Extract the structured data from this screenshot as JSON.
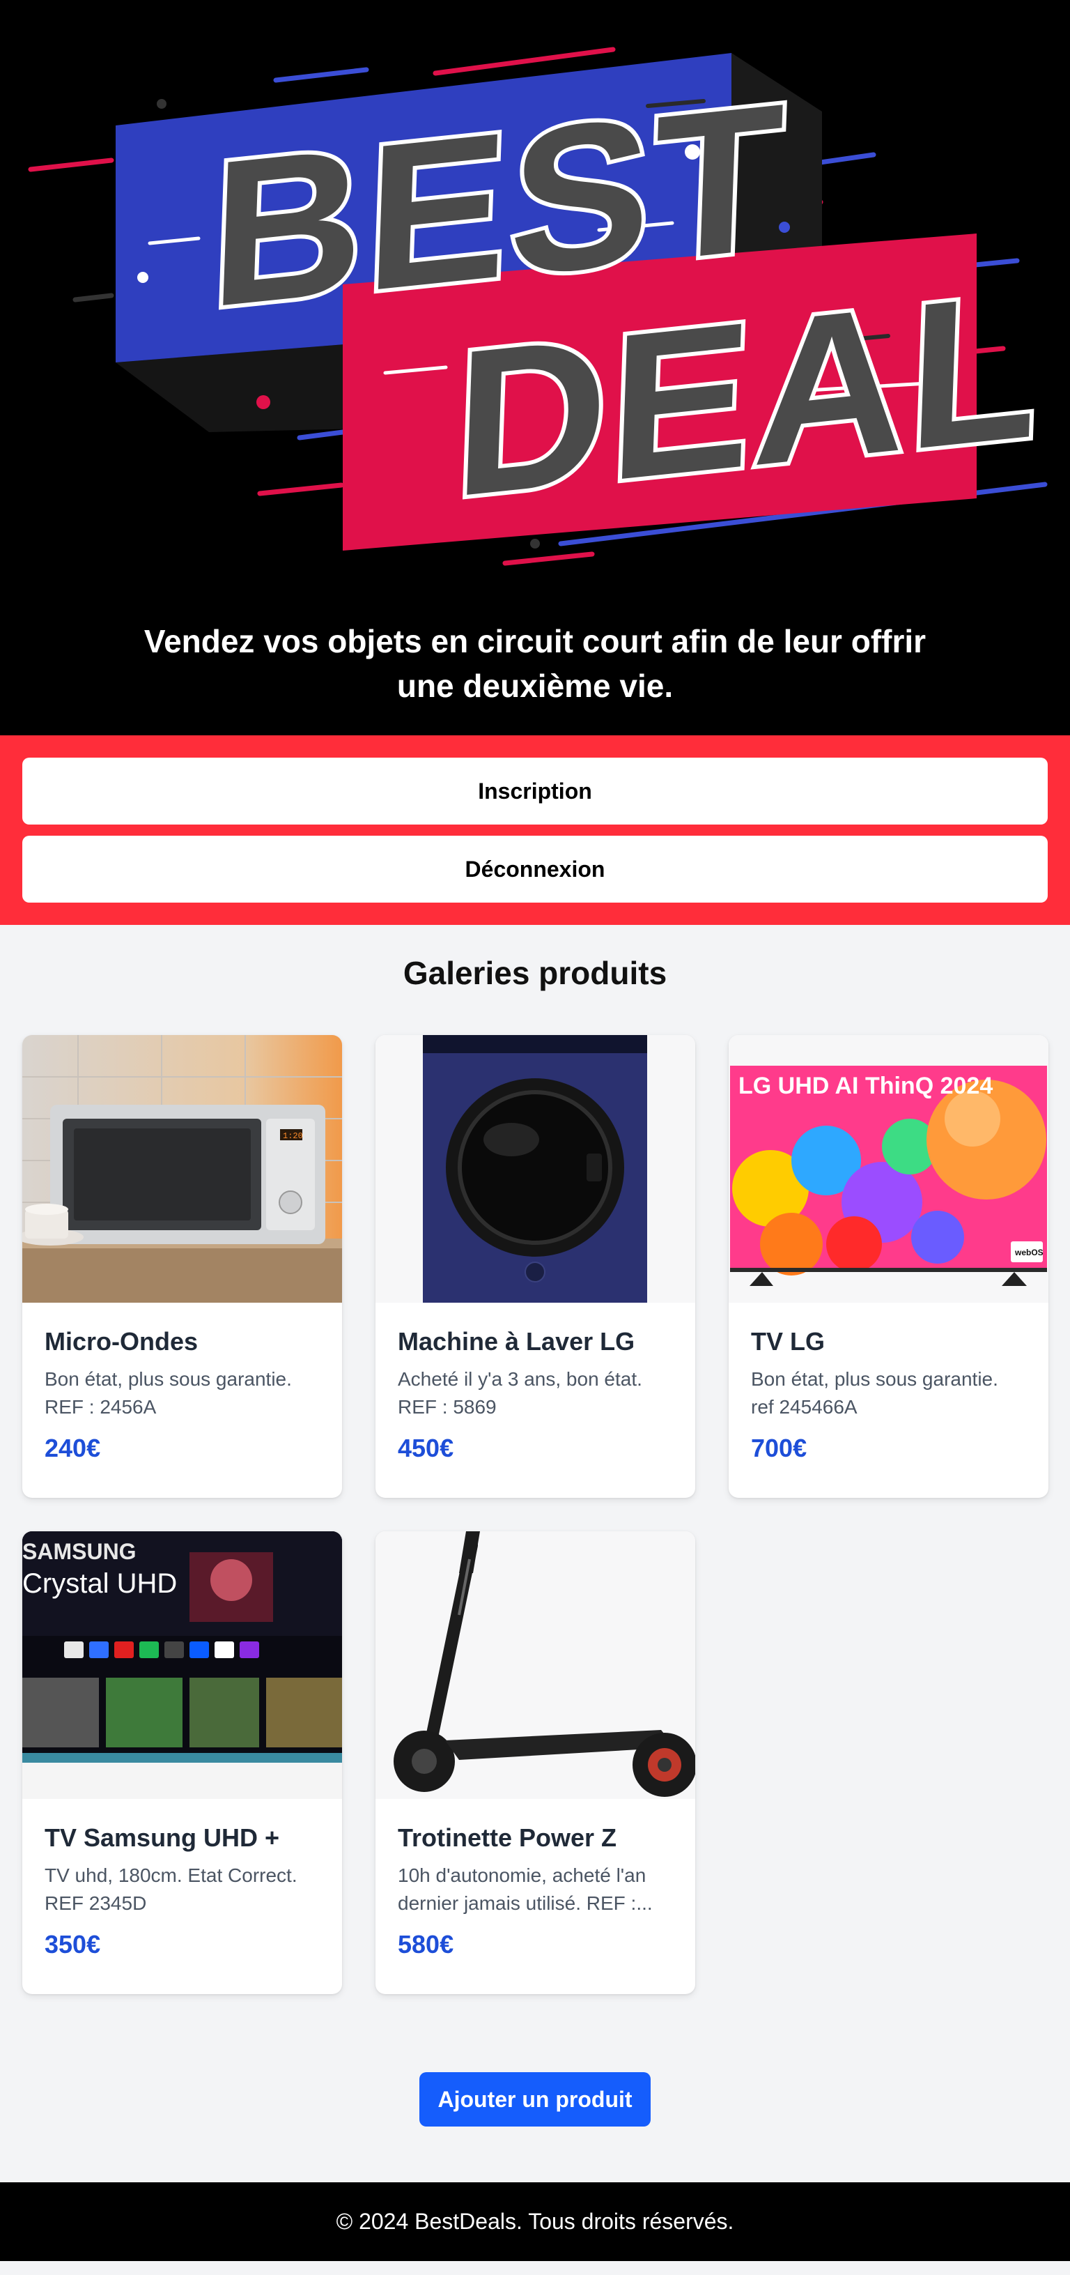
{
  "hero": {
    "logo_line1": "BEST",
    "logo_line2": "DEAL",
    "subtitle_line1": "Vendez vos objets en circuit court afin de leur offrir",
    "subtitle_line2": "une deuxième vie."
  },
  "auth": {
    "signup_label": "Inscription",
    "logout_label": "Déconnexion"
  },
  "gallery": {
    "title": "Galeries produits",
    "products": [
      {
        "title": "Micro-Ondes",
        "description": "Bon état, plus sous garantie. REF : 2456A",
        "price": "240€",
        "image": "microwave"
      },
      {
        "title": "Machine à Laver LG",
        "description": "Acheté il y'a 3 ans, bon état. REF : 5869",
        "price": "450€",
        "image": "washing-machine"
      },
      {
        "title": "TV LG",
        "description": "Bon état, plus sous garantie. ref 245466A",
        "price": "700€",
        "image": "lg-tv",
        "image_text": "LG UHD AI ThinQ 2024",
        "image_badge": "webOS"
      },
      {
        "title": "TV Samsung UHD +",
        "description": "TV uhd, 180cm. Etat Correct. REF 2345D",
        "price": "350€",
        "image": "samsung-tv",
        "image_text_1": "SAMSUNG",
        "image_text_2": "Crystal UHD"
      },
      {
        "title": "Trotinette Power Z",
        "description": "10h d'autonomie, acheté l'an dernier jamais utilisé. REF :...",
        "price": "580€",
        "image": "scooter"
      }
    ],
    "add_product_label": "Ajouter un produit"
  },
  "footer": {
    "text": "© 2024 BestDeals. Tous droits réservés."
  },
  "colors": {
    "auth_band": "#ff2d3a",
    "price": "#1d4ed8",
    "primary_button": "#155dfc",
    "banner_blue": "#2f3fbf",
    "banner_red": "#e0114a"
  }
}
